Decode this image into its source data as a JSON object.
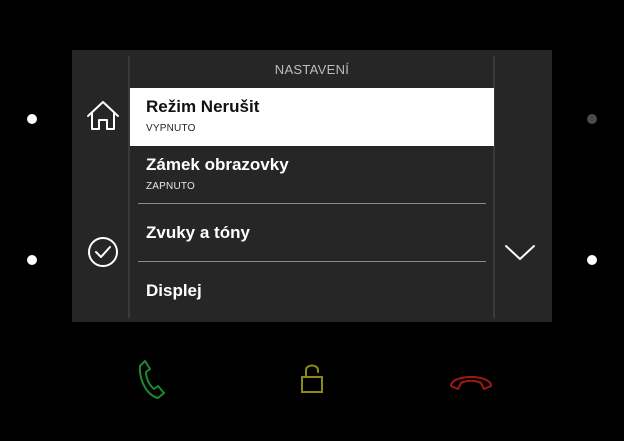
{
  "screen": {
    "title": "NASTAVENÍ"
  },
  "menu": {
    "items": [
      {
        "title": "Režim Nerušit",
        "subtitle": "VYPNUTO",
        "selected": true
      },
      {
        "title": "Zámek obrazovky",
        "subtitle": "ZAPNUTO",
        "selected": false
      },
      {
        "title": "Zvuky a tóny",
        "selected": false
      },
      {
        "title": "Displej",
        "selected": false
      }
    ]
  },
  "side_buttons": {
    "left": [
      "home-icon",
      "checkmark-circle-icon"
    ],
    "right": [
      "chevron-down-icon"
    ]
  },
  "indicator_leds": {
    "top_left": "on",
    "bottom_left": "on",
    "top_right": "off",
    "bottom_right": "on"
  },
  "hardware_buttons": [
    {
      "icon": "phone-call-icon",
      "color": "#1e8a2e"
    },
    {
      "icon": "unlock-icon",
      "color": "#8a8a14"
    },
    {
      "icon": "hang-up-icon",
      "color": "#a01818"
    }
  ],
  "colors": {
    "screen_bg": "#262626",
    "selected_bg": "#ffffff",
    "device_bg": "#000000"
  }
}
